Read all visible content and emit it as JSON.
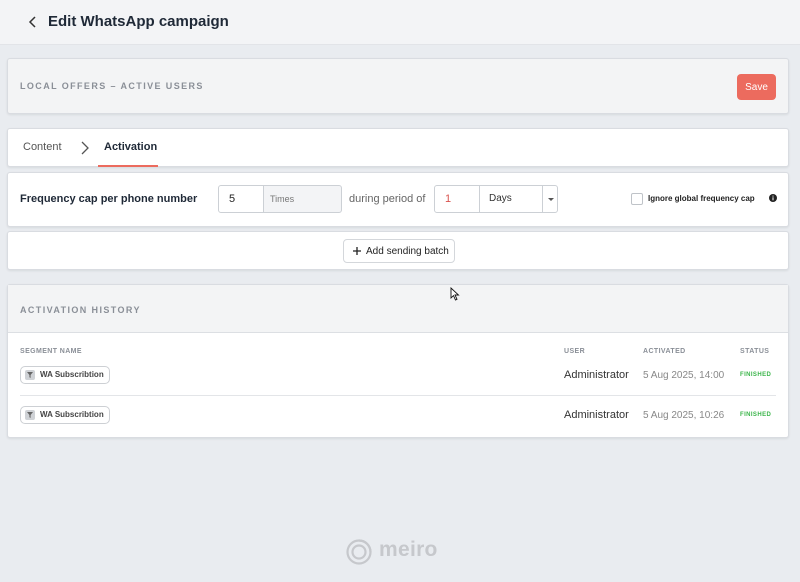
{
  "header": {
    "title": "Edit WhatsApp campaign"
  },
  "campaign": {
    "name": "LOCAL OFFERS – ACTIVE USERS",
    "save_label": "Save"
  },
  "tabs": [
    {
      "label": "Content",
      "active": false
    },
    {
      "label": "Activation",
      "active": true
    }
  ],
  "frequency": {
    "label": "Frequency cap per phone number",
    "times_value": "5",
    "times_unit": "Times",
    "during_label": "during period of",
    "period_value": "1",
    "period_unit": "Days",
    "ignore_label": "Ignore global frequency cap",
    "ignore_checked": false
  },
  "batch": {
    "add_label": "Add sending batch"
  },
  "history": {
    "title": "ACTIVATION HISTORY",
    "columns": [
      "SEGMENT NAME",
      "USER",
      "ACTIVATED",
      "STATUS"
    ],
    "rows": [
      {
        "segment": "WA Subscribtion",
        "user": "Administrator",
        "activated": "5 Aug 2025, 14:00",
        "status": "FINISHED"
      },
      {
        "segment": "WA Subscribtion",
        "user": "Administrator",
        "activated": "5 Aug 2025, 10:26",
        "status": "FINISHED"
      }
    ]
  },
  "footer": {
    "logo_text": "meiro"
  },
  "colors": {
    "accent": "#ec6b5e",
    "status_finished": "#3bb54a",
    "background": "#e9ecf0"
  }
}
